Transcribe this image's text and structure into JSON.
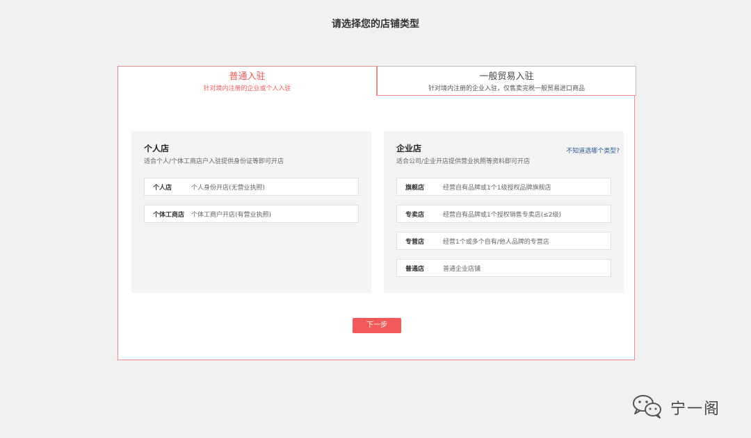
{
  "page": {
    "title": "请选择您的店铺类型"
  },
  "tabs": [
    {
      "title": "普通入驻",
      "subtitle": "针对境内注册的企业或个人入驻",
      "active": true
    },
    {
      "title": "一般贸易入驻",
      "subtitle": "针对境内注册的企业入驻，仅售卖完税一般贸易进口商品",
      "active": false
    }
  ],
  "personal": {
    "title": "个人店",
    "desc": "适合个人/个体工商店户入驻提供身份证等即可开店",
    "options": [
      {
        "name": "个人店",
        "desc": "个人身份开店(无营业执照)"
      },
      {
        "name": "个体工商店",
        "desc": "个体工商户开店(有营业执照)"
      }
    ]
  },
  "enterprise": {
    "title": "企业店",
    "desc": "适合公司/企业开店提供营业执照等资料即可开店",
    "help_link": "不知道选哪个类型?",
    "options": [
      {
        "name": "旗舰店",
        "desc": "经营自有品牌或1个1级授权品牌旗舰店"
      },
      {
        "name": "专卖店",
        "desc": "经营自有品牌或1个授权销售专卖店(≤2级)"
      },
      {
        "name": "专营店",
        "desc": "经营1个或多个自有/他人品牌的专营店"
      },
      {
        "name": "普通店",
        "desc": "普通企业店铺"
      }
    ]
  },
  "actions": {
    "next_label": "下一步"
  },
  "watermark": {
    "text": "宁一阁",
    "icon": "wechat-icon"
  },
  "colors": {
    "accent": "#f25a5a",
    "border_accent": "#f08c8c",
    "link": "#2a5b9c",
    "background": "#f1f1f1",
    "card": "#f4f4f4"
  }
}
